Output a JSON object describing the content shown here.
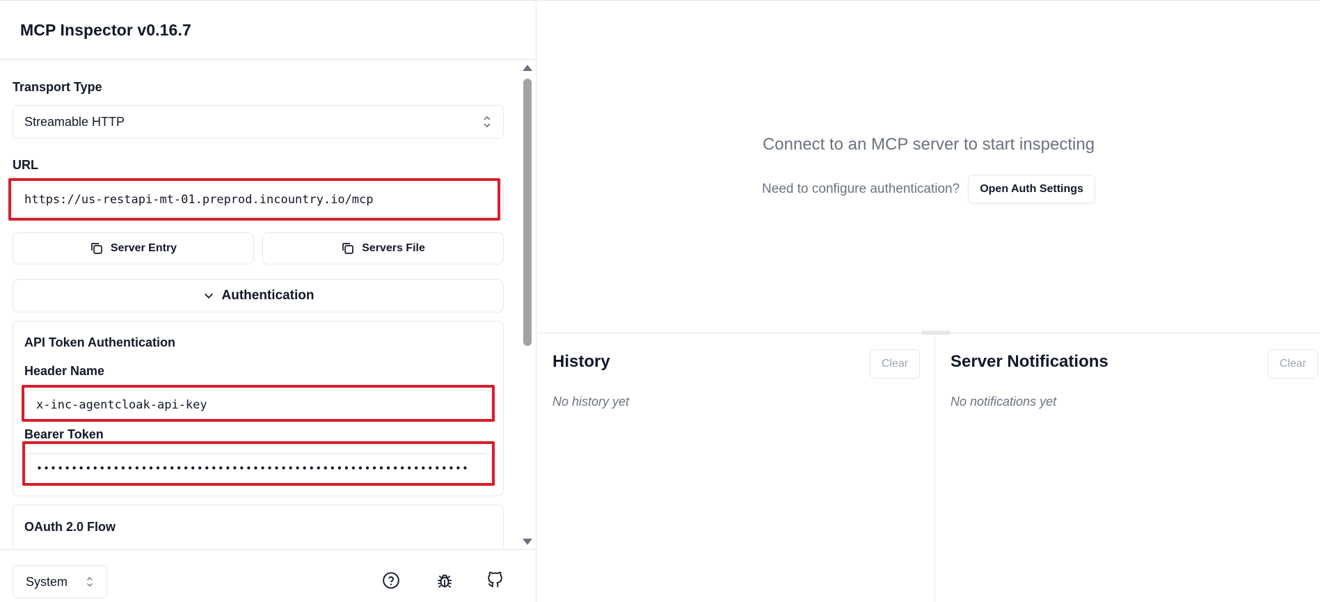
{
  "app": {
    "title": "MCP Inspector v0.16.7"
  },
  "transport": {
    "label": "Transport Type",
    "value": "Streamable HTTP"
  },
  "url": {
    "label": "URL",
    "value": "https://us-restapi-mt-01.preprod.incountry.io/mcp"
  },
  "actions": {
    "server_entry": "Server Entry",
    "servers_file": "Servers File"
  },
  "auth": {
    "toggle_label": "Authentication",
    "api_token": {
      "title": "API Token Authentication",
      "header_name_label": "Header Name",
      "header_name_value": "x-inc-agentcloak-api-key",
      "bearer_label": "Bearer Token",
      "bearer_value": "••••••••••••••••••••••••••••••••••••••••••••••••••••••••••••••"
    },
    "oauth": {
      "title": "OAuth 2.0 Flow"
    }
  },
  "footer": {
    "theme_value": "System",
    "icons": [
      "help-circle-icon",
      "bug-icon",
      "github-icon"
    ]
  },
  "main": {
    "connect_message": "Connect to an MCP server to start inspecting",
    "auth_question": "Need to configure authentication?",
    "auth_button": "Open Auth Settings"
  },
  "history": {
    "title": "History",
    "clear": "Clear",
    "empty": "No history yet"
  },
  "notifications": {
    "title": "Server Notifications",
    "clear": "Clear",
    "empty": "No notifications yet"
  },
  "colors": {
    "highlight": "#d71f2b",
    "border": "#e5e7eb",
    "muted_text": "#6b7280"
  }
}
